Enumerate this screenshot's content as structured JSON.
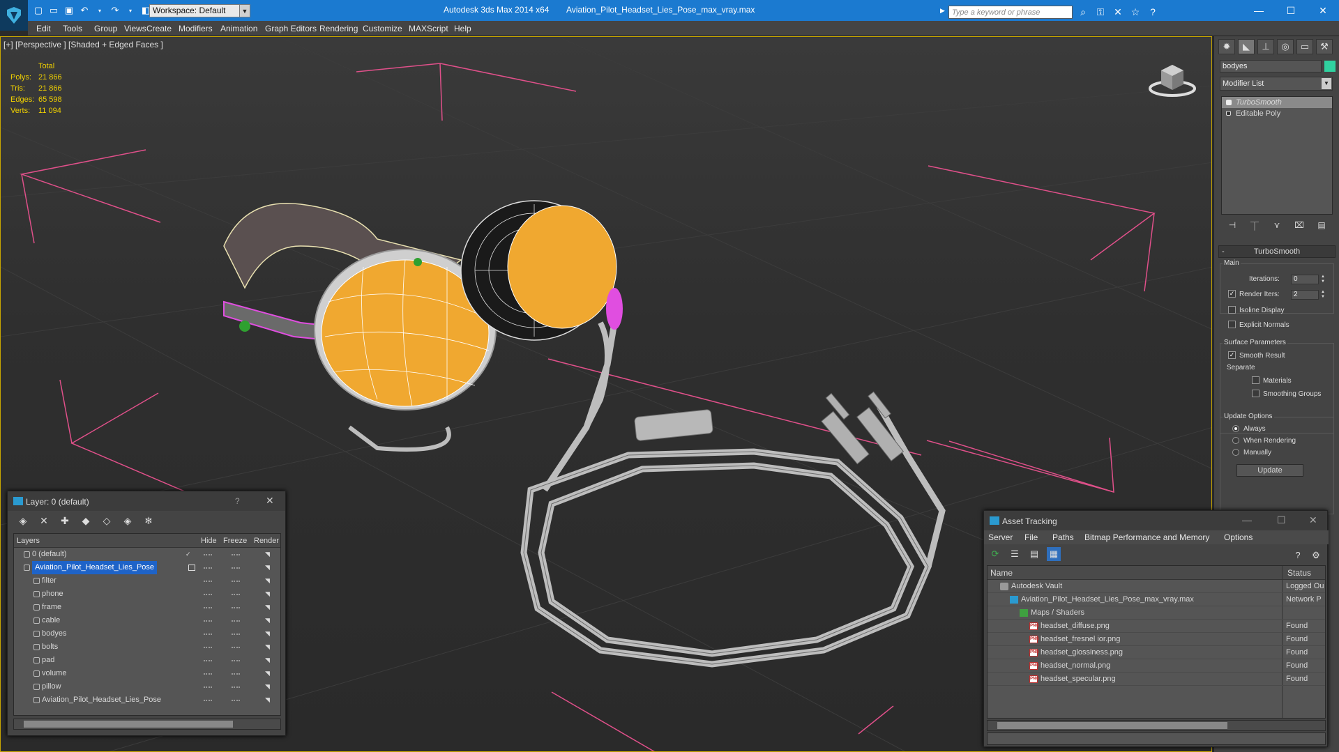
{
  "titlebar": {
    "app_title": "Autodesk 3ds Max  2014 x64",
    "file_title": "Aviation_Pilot_Headset_Lies_Pose_max_vray.max",
    "workspace": "Workspace: Default",
    "search_placeholder": "Type a keyword or phrase",
    "quick_access_icons": [
      "new-icon",
      "open-icon",
      "save-icon",
      "undo-icon",
      "redo-icon",
      "project-icon"
    ],
    "info_icons": [
      "binoculars-icon",
      "key-icon",
      "exchange-icon",
      "star-icon",
      "help-icon"
    ]
  },
  "menu": [
    "Edit",
    "Tools",
    "Group",
    "Views",
    "Create",
    "Modifiers",
    "Animation",
    "Graph Editors",
    "Rendering",
    "Customize",
    "MAXScript",
    "Help"
  ],
  "viewport": {
    "label": "[+] [Perspective ] [Shaded + Edged Faces ]",
    "stats": {
      "header": "Total",
      "rows": [
        {
          "label": "Polys:",
          "value": "21 866"
        },
        {
          "label": "Tris:",
          "value": "21 866"
        },
        {
          "label": "Edges:",
          "value": "65 598"
        },
        {
          "label": "Verts:",
          "value": "11 094"
        }
      ]
    },
    "colors": {
      "earcup": "#f0a830",
      "wire": "#ffffff",
      "selection": "#e04ee0",
      "grid_marker": "#e0508a"
    }
  },
  "command_panel": {
    "tabs": [
      "create-icon",
      "modify-icon",
      "hierarchy-icon",
      "motion-icon",
      "display-icon",
      "utilities-icon"
    ],
    "object_name": "bodyes",
    "object_color": "#30d2a0",
    "modifier_list": "Modifier List",
    "stack": [
      "TurboSmooth",
      "Editable Poly"
    ],
    "rollout_title": "TurboSmooth",
    "main_group": "Main",
    "iterations_label": "Iterations:",
    "iterations_value": "0",
    "render_iters_label": "Render Iters:",
    "render_iters_value": "2",
    "isoline_label": "Isoline Display",
    "explicit_normals_label": "Explicit Normals",
    "surface_group": "Surface Parameters",
    "smooth_result_label": "Smooth Result",
    "separate_label": "Separate",
    "materials_label": "Materials",
    "smoothing_groups_label": "Smoothing Groups",
    "update_group": "Update Options",
    "always_label": "Always",
    "when_rendering_label": "When Rendering",
    "manually_label": "Manually",
    "update_button": "Update"
  },
  "layer_dialog": {
    "title": "Layer: 0 (default)",
    "help": "?",
    "columns": {
      "layers": "Layers",
      "hide": "Hide",
      "freeze": "Freeze",
      "render": "Render"
    },
    "rows": [
      {
        "name": "0 (default)",
        "kind": "layer"
      },
      {
        "name": "Aviation_Pilot_Headset_Lies_Pose",
        "kind": "active"
      },
      {
        "name": "filter",
        "kind": "object"
      },
      {
        "name": "phone",
        "kind": "object"
      },
      {
        "name": "frame",
        "kind": "object"
      },
      {
        "name": "cable",
        "kind": "object"
      },
      {
        "name": "bodyes",
        "kind": "object"
      },
      {
        "name": "bolts",
        "kind": "object"
      },
      {
        "name": "pad",
        "kind": "object"
      },
      {
        "name": "volume",
        "kind": "object"
      },
      {
        "name": "pillow",
        "kind": "object"
      },
      {
        "name": "Aviation_Pilot_Headset_Lies_Pose",
        "kind": "object"
      }
    ]
  },
  "asset_dialog": {
    "title": "Asset Tracking",
    "menu": [
      "Server",
      "File",
      "Paths",
      "Bitmap Performance and Memory",
      "Options"
    ],
    "columns": {
      "name": "Name",
      "status": "Status"
    },
    "rows": [
      {
        "name": "Autodesk Vault",
        "status": "Logged Ou",
        "indent": 1,
        "icon": "vault"
      },
      {
        "name": "Aviation_Pilot_Headset_Lies_Pose_max_vray.max",
        "status": "Network P",
        "indent": 2,
        "icon": "maxf"
      },
      {
        "name": "Maps / Shaders",
        "status": "",
        "indent": 3,
        "icon": "maps"
      },
      {
        "name": "headset_diffuse.png",
        "status": "Found",
        "indent": 4,
        "icon": "png"
      },
      {
        "name": "headset_fresnel ior.png",
        "status": "Found",
        "indent": 4,
        "icon": "png"
      },
      {
        "name": "headset_glossiness.png",
        "status": "Found",
        "indent": 4,
        "icon": "png"
      },
      {
        "name": "headset_normal.png",
        "status": "Found",
        "indent": 4,
        "icon": "png"
      },
      {
        "name": "headset_specular.png",
        "status": "Found",
        "indent": 4,
        "icon": "png"
      }
    ]
  }
}
